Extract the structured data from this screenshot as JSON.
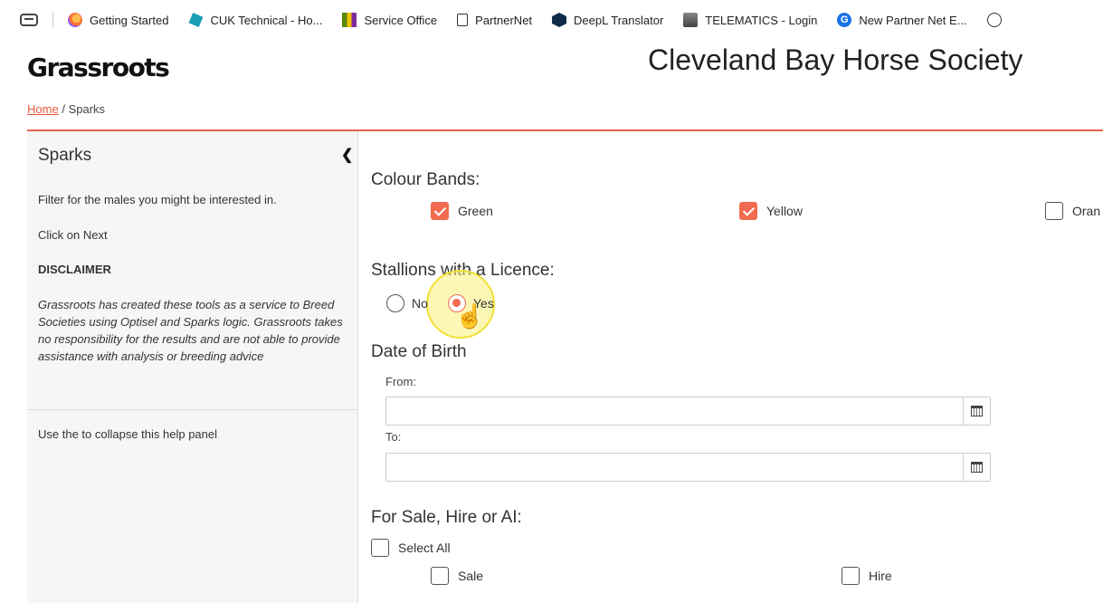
{
  "bookmarks": [
    {
      "icon": "firefox-icon",
      "label": "Getting Started"
    },
    {
      "icon": "cuk-icon",
      "label": "CUK Technical - Ho..."
    },
    {
      "icon": "service-office-icon",
      "label": "Service Office"
    },
    {
      "icon": "document-icon",
      "label": "PartnerNet"
    },
    {
      "icon": "deepl-icon",
      "label": "DeepL Translator"
    },
    {
      "icon": "telematics-icon",
      "label": "TELEMATICS - Login"
    },
    {
      "icon": "g-icon",
      "label": "New Partner Net E..."
    }
  ],
  "header": {
    "logo": "Grassroots",
    "society": "Cleveland Bay Horse Society"
  },
  "breadcrumb": {
    "home": "Home",
    "separator": "/",
    "current": "Sparks"
  },
  "sidebar": {
    "title": "Sparks",
    "intro": "Filter for the males you might be interested in.",
    "next_hint": "Click on Next",
    "disclaimer_heading": "DISCLAIMER",
    "disclaimer_text": "Grassroots has created these tools as a service to Breed Societies using Optisel and Sparks logic. Grassroots takes no responsibility for the results and are not able to provide assistance with analysis or breeding advice",
    "collapse_hint": "Use the to collapse this help panel"
  },
  "colour_bands": {
    "title": "Colour Bands:",
    "options": [
      {
        "label": "Green",
        "checked": true
      },
      {
        "label": "Yellow",
        "checked": true
      },
      {
        "label": "Oran",
        "checked": false
      }
    ]
  },
  "licence": {
    "title": "Stallions with a Licence:",
    "no_label": "No",
    "yes_label": "Yes",
    "selected": "Yes"
  },
  "dob": {
    "title": "Date of Birth",
    "from_label": "From:",
    "from_value": "",
    "to_label": "To:",
    "to_value": ""
  },
  "sale": {
    "title": "For Sale, Hire or AI:",
    "select_all": "Select All",
    "sale_label": "Sale",
    "hire_label": "Hire"
  },
  "colors": {
    "accent": "#f26a4f",
    "rule": "#e8614a",
    "link": "#e85a3c"
  }
}
